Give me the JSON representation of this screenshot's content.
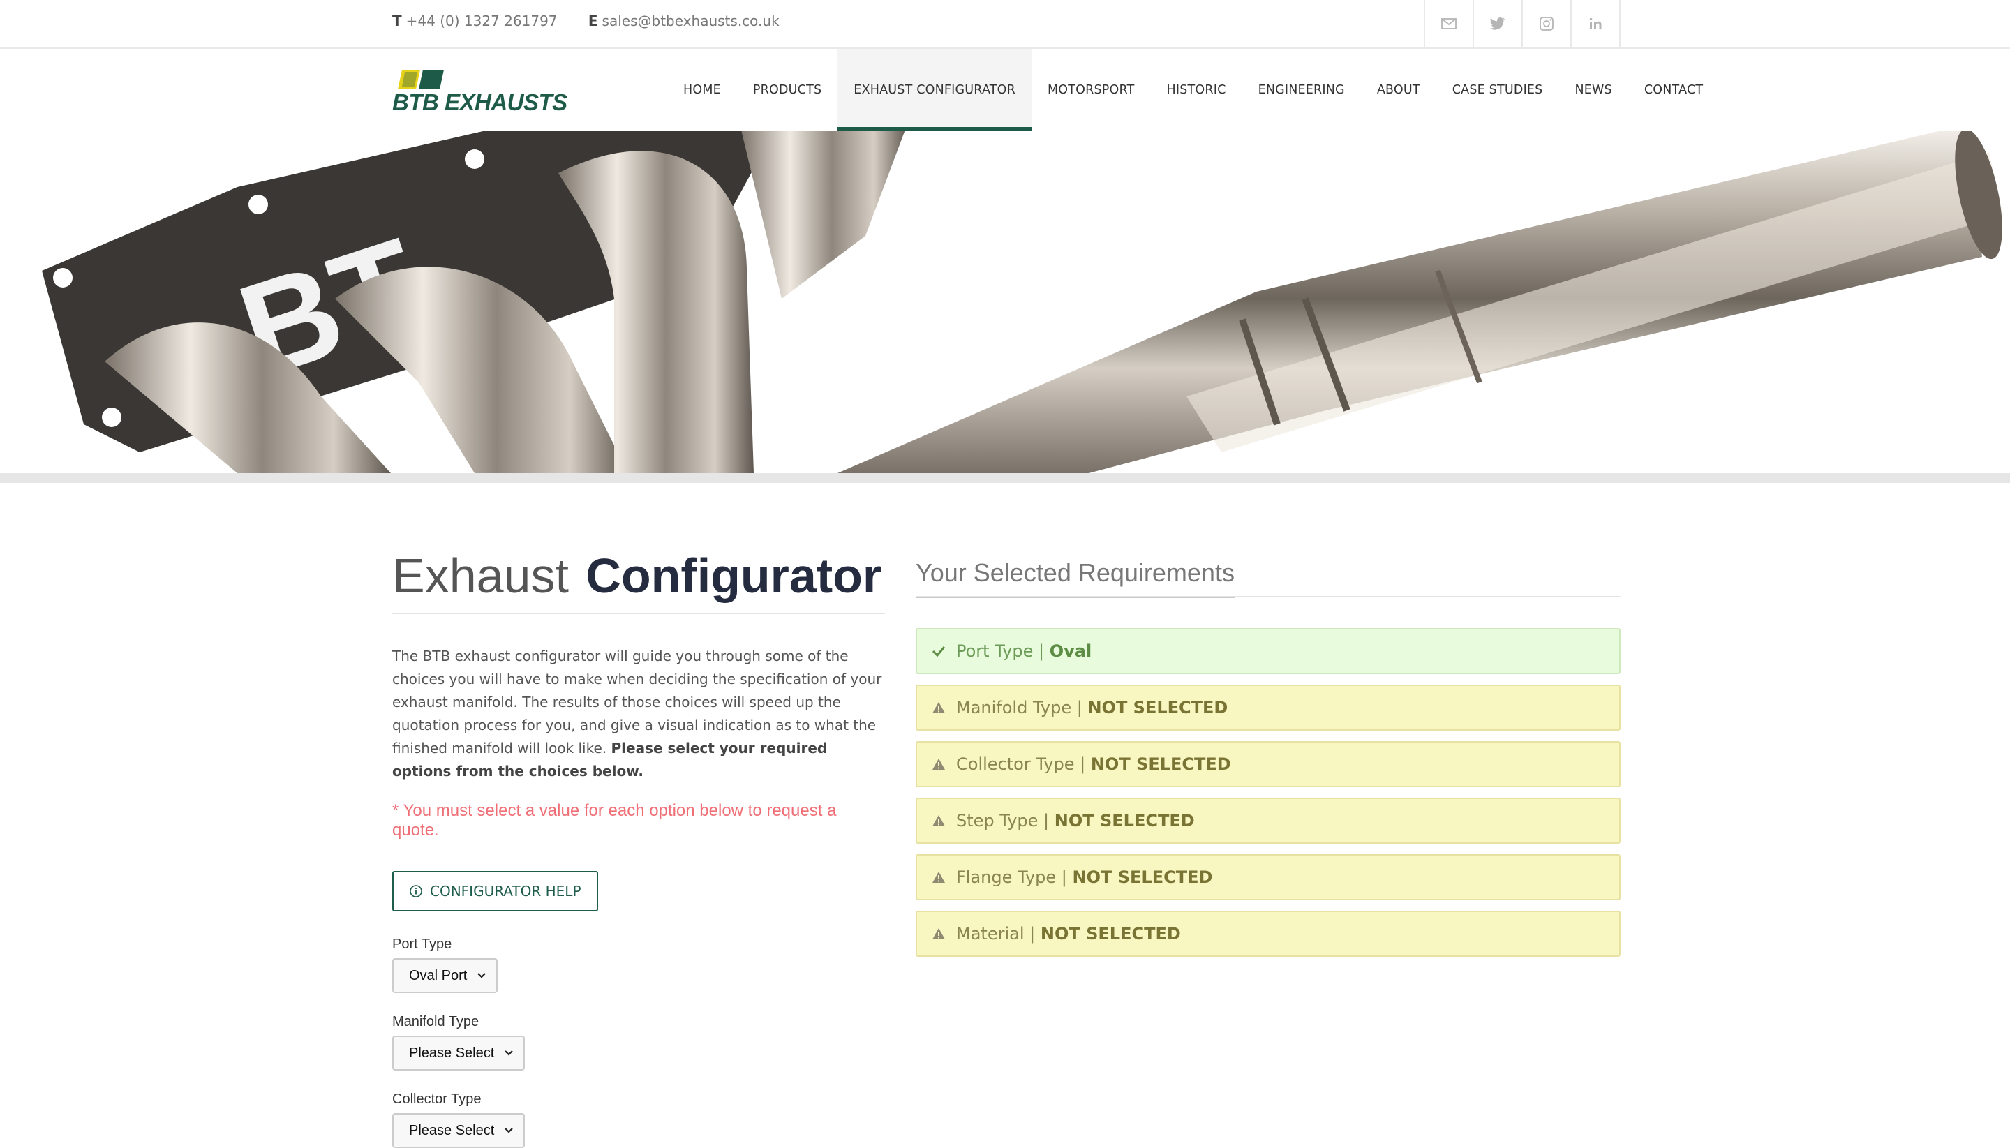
{
  "topbar": {
    "phone_prefix": "T",
    "phone": "+44 (0) 1327 261797",
    "email_prefix": "E",
    "email": "sales@btbexhausts.co.uk",
    "social_icons": [
      "mail-icon",
      "twitter-icon",
      "instagram-icon",
      "linkedin-icon"
    ]
  },
  "logo": {
    "text": "BTB EXHAUSTS",
    "colors": {
      "yellow": "#e6d21a",
      "green": "#1d5a47"
    }
  },
  "nav": {
    "items": [
      {
        "label": "HOME"
      },
      {
        "label": "PRODUCTS"
      },
      {
        "label": "EXHAUST CONFIGURATOR",
        "active": true
      },
      {
        "label": "MOTORSPORT"
      },
      {
        "label": "HISTORIC"
      },
      {
        "label": "ENGINEERING"
      },
      {
        "label": "ABOUT"
      },
      {
        "label": "CASE STUDIES"
      },
      {
        "label": "NEWS"
      },
      {
        "label": "CONTACT"
      }
    ]
  },
  "hero": {
    "watermark": "BT"
  },
  "main": {
    "title_light": "Exhaust",
    "title_strong": "Configurator",
    "intro": "The BTB exhaust configurator will guide you through some of the choices you will have to make when deciding the specification of your exhaust manifold. The results of those choices will speed up the quotation process for you, and give a visual indication as to what the finished manifold will look like.",
    "intro_bold": "Please select your required options from the choices below.",
    "warning": "* You must select a value for each option below to request a quote.",
    "help_button": "CONFIGURATOR HELP",
    "fields": [
      {
        "label": "Port Type",
        "value": "Oval Port"
      },
      {
        "label": "Manifold Type",
        "value": "Please Select"
      },
      {
        "label": "Collector Type",
        "value": "Please Select"
      }
    ]
  },
  "requirements": {
    "title": "Your Selected Requirements",
    "separator": "|",
    "items": [
      {
        "label": "Port Type",
        "value": "Oval",
        "status": "ok"
      },
      {
        "label": "Manifold Type",
        "value": "NOT SELECTED",
        "status": "pending"
      },
      {
        "label": "Collector Type",
        "value": "NOT SELECTED",
        "status": "pending"
      },
      {
        "label": "Step Type",
        "value": "NOT SELECTED",
        "status": "pending"
      },
      {
        "label": "Flange Type",
        "value": "NOT SELECTED",
        "status": "pending"
      },
      {
        "label": "Material",
        "value": "NOT SELECTED",
        "status": "pending"
      }
    ]
  },
  "colors": {
    "brand_green": "#1d5a47",
    "ok_bg": "#e8fbdc",
    "pending_bg": "#f8f6c1",
    "warning": "#f06f77"
  }
}
